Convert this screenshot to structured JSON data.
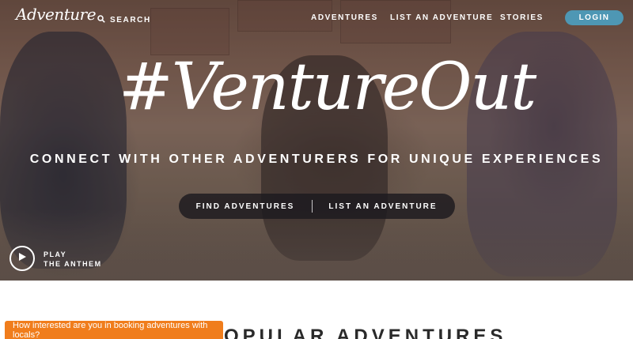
{
  "brand": {
    "logo_text": "Adventure"
  },
  "nav": {
    "search_label": "SEARCH",
    "links": [
      "ADVENTURES",
      "LIST AN ADVENTURE",
      "STORIES"
    ],
    "login_label": "LOGIN"
  },
  "hero": {
    "hashtag": "#VentureOut",
    "tagline": "CONNECT WITH OTHER ADVENTURERS FOR UNIQUE EXPERIENCES",
    "cta_find": "FIND ADVENTURES",
    "cta_list": "LIST AN ADVENTURE",
    "play_label_1": "PLAY",
    "play_label_2": "THE ANTHEM"
  },
  "popular": {
    "title": "SOME POPULAR ADVENTURES"
  },
  "feedback": {
    "text": "How interested are you in booking adventures with locals?"
  },
  "colors": {
    "login_bg": "#4e97b4",
    "feedback_bg": "#f07d1c",
    "cta_bg": "#1c1a1e"
  },
  "icons": {
    "search": "search-icon",
    "play": "play-icon"
  }
}
